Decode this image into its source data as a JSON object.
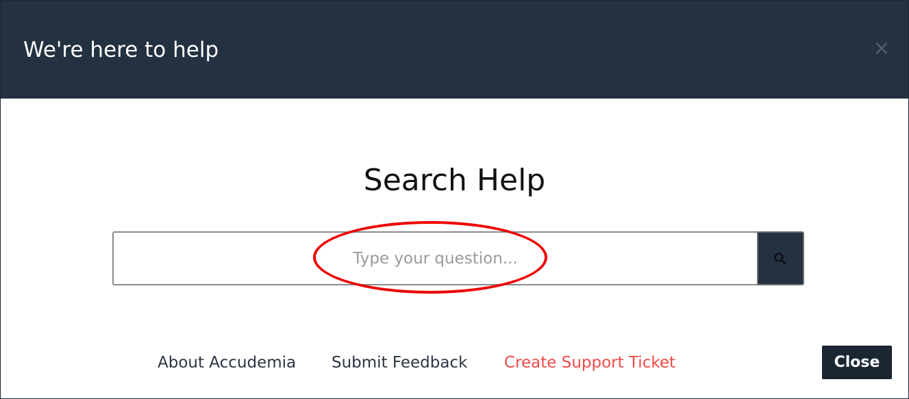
{
  "header": {
    "title": "We're here to help",
    "close_icon": "×"
  },
  "search": {
    "heading": "Search Help",
    "placeholder": "Type your question...",
    "value": "",
    "button_icon": "search-icon"
  },
  "annotation": {
    "shape": "ellipse",
    "color": "#ee0000"
  },
  "footer": {
    "links": [
      {
        "label": "About Accudemia"
      },
      {
        "label": "Submit Feedback"
      },
      {
        "label": "Create Support Ticket",
        "color": "#ee4b47"
      }
    ],
    "close_label": "Close"
  },
  "colors": {
    "header_bg": "#233140",
    "button_bg": "#1b2633",
    "link_color": "#2b3644",
    "accent_link": "#ee4b47"
  }
}
